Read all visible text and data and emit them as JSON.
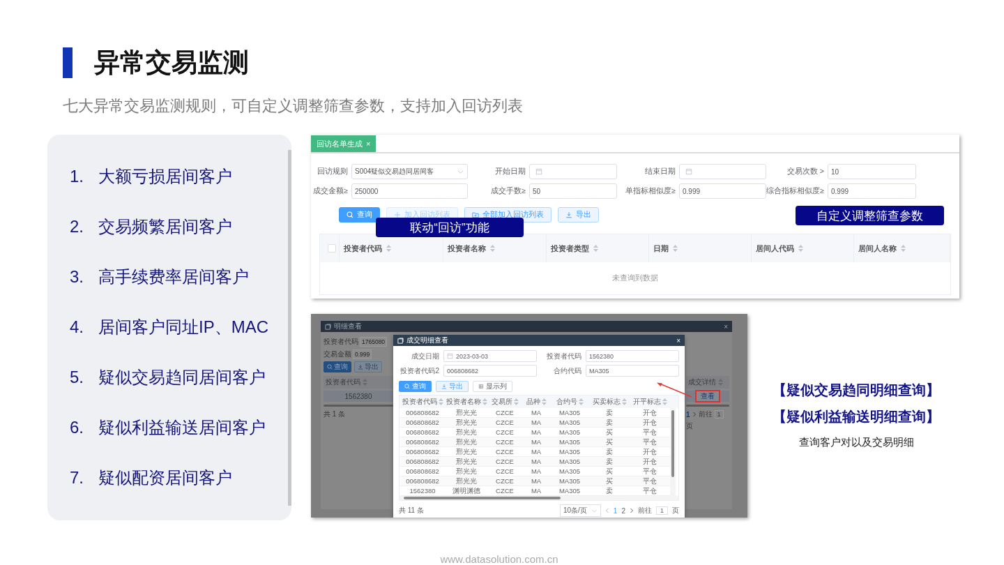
{
  "title": "异常交易监测",
  "subtitle": "七大异常交易监测规则，可自定义调整筛查参数，支持加入回访列表",
  "rules": [
    {
      "number": "1.",
      "text": "大额亏损居间客户"
    },
    {
      "number": "2.",
      "text": "交易频繁居间客户"
    },
    {
      "number": "3.",
      "text": "高手续费率居间客户"
    },
    {
      "number": "4.",
      "text": "居间客户同址IP、MAC"
    },
    {
      "number": "5.",
      "text": "疑似交易趋同居间客户"
    },
    {
      "number": "6.",
      "text": "疑似利益输送居间客户"
    },
    {
      "number": "7.",
      "text": "疑似配资居间客户"
    }
  ],
  "filter_screen": {
    "tabs": [
      {
        "label": "回访名单生成",
        "close": "×",
        "selected": true
      }
    ],
    "fields": [
      {
        "label": "回访规则",
        "kind": "select",
        "value": "S004疑似交易趋同居间客"
      },
      {
        "label": "开始日期",
        "kind": "date"
      },
      {
        "label": "结束日期",
        "kind": "date"
      },
      {
        "label": "交易次数 >",
        "kind": "text",
        "value": "10"
      },
      {
        "label": "成交金额≥",
        "kind": "text",
        "value": "250000"
      },
      {
        "label": "成交手数≥",
        "kind": "text",
        "value": "50"
      },
      {
        "label": "单指标相似度≥",
        "kind": "text",
        "value": "0.999"
      },
      {
        "label": "综合指标相似度≥",
        "kind": "text",
        "value": "0.999"
      }
    ],
    "buttons": [
      {
        "label": "查询",
        "kind": "search",
        "disabled": false
      },
      {
        "label": "加入回访列表",
        "kind": "add",
        "disabled": true
      },
      {
        "label": "全部加入回访列表",
        "kind": "add-all",
        "disabled": false
      },
      {
        "label": "导出",
        "kind": "export",
        "disabled": false
      }
    ],
    "header_checkbox": {
      "checked": false
    },
    "columns": [
      "投资者代码",
      "投资者名称",
      "投资者类型",
      "日期",
      "居间人代码",
      "居间人名称"
    ],
    "empty_text": "未查询到数据"
  },
  "callouts": [
    {
      "text": "联动“回访”功能"
    },
    {
      "text": "自定义调整筛查参数"
    }
  ],
  "detail_screen": {
    "outer_dialog": {
      "title": "明细查看",
      "close": "×",
      "fields": [
        {
          "label": "投资者代码",
          "value": "1765080"
        },
        {
          "label": "交易金额",
          "value": "0.999"
        }
      ],
      "buttons": [
        {
          "label": "查询",
          "kind": "search"
        },
        {
          "label": "导出",
          "kind": "export"
        }
      ],
      "column": "投资者代码",
      "cell": "1562380",
      "detail_column": "成交详情",
      "view_button": "查看",
      "total": "共 1 条",
      "pages": [
        {
          "label": "1",
          "selected": true
        }
      ],
      "goto": "前往",
      "page": "1",
      "page_unit": "页"
    },
    "dialog": {
      "title": "成交明细查看",
      "close": "×",
      "filters": [
        {
          "label": "成交日期",
          "kind": "date",
          "value": "2023-03-03"
        },
        {
          "label": "投资者代码",
          "kind": "text",
          "value": "1562380"
        },
        {
          "label": "投资者代码2",
          "kind": "text",
          "value": "006808682"
        },
        {
          "label": "合约代码",
          "kind": "text",
          "value": "MA305"
        }
      ],
      "buttons": [
        {
          "label": "查询",
          "kind": "search"
        },
        {
          "label": "导出",
          "kind": "export"
        },
        {
          "label": "显示列",
          "kind": "columns"
        }
      ],
      "columns": [
        "投资者代码",
        "投资者名称",
        "交易所",
        "品种",
        "合约号",
        "买卖标志",
        "开平标志"
      ],
      "rows": [
        [
          "006808682",
          "邢光光",
          "CZCE",
          "MA",
          "MA305",
          "卖",
          "开仓"
        ],
        [
          "006808682",
          "邢光光",
          "CZCE",
          "MA",
          "MA305",
          "卖",
          "开仓"
        ],
        [
          "006808682",
          "邢光光",
          "CZCE",
          "MA",
          "MA305",
          "买",
          "平仓"
        ],
        [
          "006808682",
          "邢光光",
          "CZCE",
          "MA",
          "MA305",
          "买",
          "平仓"
        ],
        [
          "006808682",
          "邢光光",
          "CZCE",
          "MA",
          "MA305",
          "卖",
          "开仓"
        ],
        [
          "006808682",
          "邢光光",
          "CZCE",
          "MA",
          "MA305",
          "卖",
          "开仓"
        ],
        [
          "006808682",
          "邢光光",
          "CZCE",
          "MA",
          "MA305",
          "买",
          "平仓"
        ],
        [
          "006808682",
          "邢光光",
          "CZCE",
          "MA",
          "MA305",
          "买",
          "平仓"
        ],
        [
          "1562380",
          "渊明渊德",
          "CZCE",
          "MA",
          "MA305",
          "卖",
          "平仓"
        ]
      ],
      "total": "共 11 条",
      "page_size": "10条/页",
      "pages": [
        {
          "label": "1",
          "selected": true
        },
        {
          "label": "2",
          "selected": false
        }
      ],
      "goto": "前往",
      "page": "1",
      "page_unit": "页"
    }
  },
  "notes": [
    {
      "kind": "heading",
      "text": "【疑似交易趋同明细查询】"
    },
    {
      "kind": "heading",
      "text": "【疑似利益输送明细查询】"
    },
    {
      "kind": "caption",
      "text": "查询客户对以及交易明细"
    }
  ],
  "footer": "www.datasolution.com.cn"
}
